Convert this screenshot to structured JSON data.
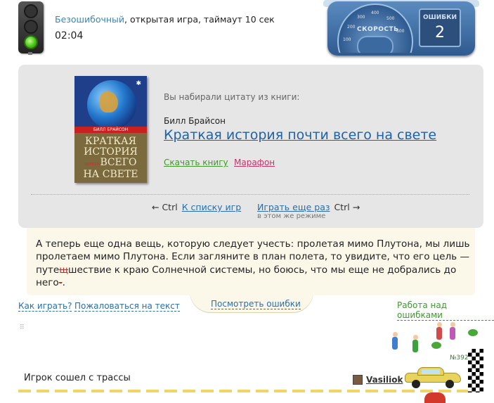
{
  "header": {
    "mode_link": "Безошибочный",
    "mode_rest": ", открытая игра, таймаут 10 сек",
    "timer": "02:04"
  },
  "dashboard": {
    "speed_label": "СКОРОСТЬ",
    "ticks": [
      "100",
      "200",
      "300",
      "400",
      "500",
      "600"
    ],
    "errors_label": "ОШИБКИ",
    "errors_count": "2"
  },
  "book": {
    "cover_author": "БИЛЛ БРАЙСОН",
    "cover_line1": "КРАТКАЯ",
    "cover_line2": "ИСТОРИЯ",
    "cover_small": "почти",
    "cover_line3": "ВСЕГО",
    "cover_line4": "НА СВЕТЕ",
    "typed_label": "Вы набирали цитату из книги:",
    "author": "Билл Брайсон",
    "title": "Краткая история почти всего на свете",
    "download": "Скачать книгу",
    "marathon": "Марафон"
  },
  "nav": {
    "back_key": "← Ctrl",
    "back_link": "К списку игр",
    "again_link": "Играть еще раз",
    "again_key": "Ctrl →",
    "again_note": "в этом же режиме"
  },
  "quote": {
    "part1": "А теперь еще одна вещь, которую следует учесть: пролетая мимо Плутона, мы лишь пролетаем мимо Плутона. Если загляните в план полета, то увидите, что его цель — путе",
    "err1": "щ",
    "part2": "шествие к краю Солнечной системы, но боюсь, что мы еще не добрались до него",
    "err2": "-",
    "part3": "."
  },
  "links": {
    "how_to_play": "Как играть?",
    "complain": "Пожаловаться на текст",
    "view_errors": "Посмотреть ошибки",
    "work_errors": "Работа над ошибками"
  },
  "track": {
    "status": "Игрок сошел с трассы",
    "player": "Vasiliok",
    "badge": "№392"
  },
  "colors": {
    "link": "#2a6fa9",
    "green_link": "#3d9a2a",
    "red_link": "#c0356a",
    "card_bg": "#e6e6e6",
    "quote_bg": "#fbf8ea"
  }
}
